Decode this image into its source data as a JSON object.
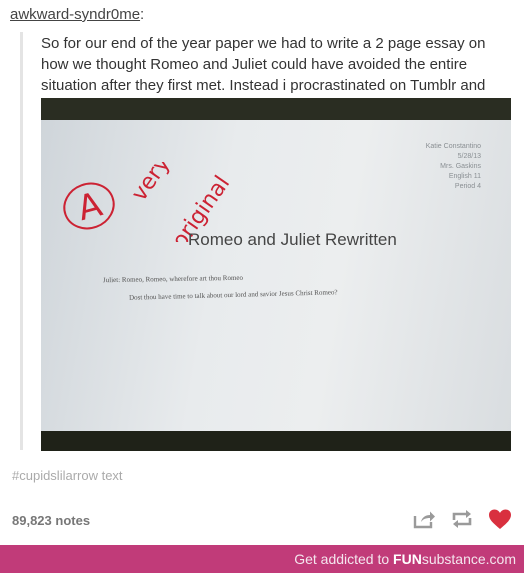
{
  "post": {
    "username": "awkward-syndr0me",
    "username_suffix": ":",
    "caption": "So for our end of the year paper we had to write a 2 page essay on how we thought Romeo and Juliet could have avoided the entire situation after they first met. Instead i procrastinated  on Tumblr and turned this in.",
    "tag": "#cupidslilarrow text",
    "notes": "89,823 notes"
  },
  "photo": {
    "grade_letter": "A",
    "grade_comment": [
      "very",
      "original"
    ],
    "header_lines": [
      "Katie Constantino",
      "5/28/13",
      "Mrs. Gaskins",
      "English 11",
      "Period 4"
    ],
    "doc_title": "Romeo and Juliet Rewritten",
    "line1": "Juliet: Romeo, Romeo, wherefore art thou Romeo",
    "line2": "Dost thou have time to talk about our lord and savior Jesus Christ Romeo?"
  },
  "footer": {
    "prefix": "Get addicted to ",
    "brand_bold": "FUN",
    "brand_rest": "substance",
    "suffix": ".com"
  },
  "colors": {
    "footer_bg": "#c13b79",
    "heart": "#d9303f",
    "grade_red": "#cc2233"
  },
  "icons": [
    "share-icon",
    "reblog-icon",
    "heart-icon"
  ]
}
